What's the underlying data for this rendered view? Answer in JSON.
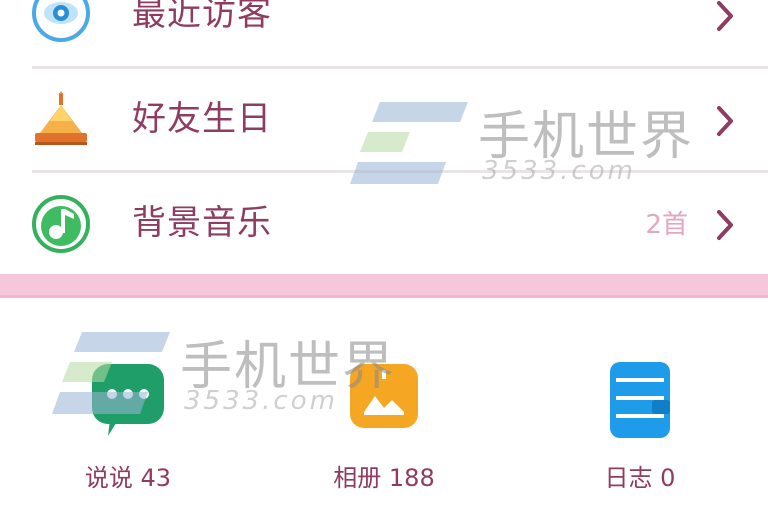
{
  "rows": [
    {
      "label": "最近访客",
      "count": "",
      "icon": "eye-icon"
    },
    {
      "label": "好友生日",
      "count": "",
      "icon": "birthday-cake-icon"
    },
    {
      "label": "背景音乐",
      "count": "2首",
      "icon": "music-note-icon"
    }
  ],
  "grid": [
    {
      "label": "说说 43",
      "icon": "chat-bubble-icon"
    },
    {
      "label": "相册 188",
      "icon": "photo-album-icon"
    },
    {
      "label": "日志 0",
      "icon": "diary-icon"
    }
  ],
  "watermark": {
    "title": "手机世界",
    "url": "3533.com"
  },
  "colors": {
    "label": "#8e3c61",
    "accent_pink": "#f6c7da",
    "count": "#e3a7c1",
    "chat_green": "#1f9e6a",
    "album_orange": "#f5a623",
    "diary_blue": "#1e9be9"
  }
}
